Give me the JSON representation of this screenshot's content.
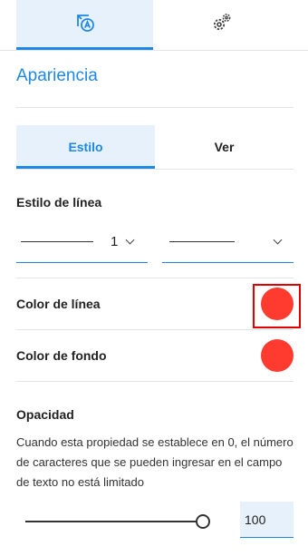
{
  "top_tabs": [
    {
      "icon": "appearance-icon",
      "active": true
    },
    {
      "icon": "gear-icon",
      "active": false
    }
  ],
  "section": {
    "title": "Apariencia"
  },
  "sub_tabs": [
    {
      "label": "Estilo",
      "active": true
    },
    {
      "label": "Ver",
      "active": false
    }
  ],
  "line_style": {
    "label": "Estilo de línea",
    "width_value": "1"
  },
  "line_color": {
    "label": "Color de línea",
    "color": "#ff3b2f"
  },
  "fill_color": {
    "label": "Color de fondo",
    "color": "#ff3b2f"
  },
  "opacity": {
    "label": "Opacidad",
    "description": "Cuando esta propiedad se establece en 0, el número de caracteres que se pueden ingresar en el campo de texto no está limitado",
    "value": "100",
    "slider_fraction": 1.0
  },
  "colors": {
    "accent": "#1e88e5",
    "accent_bg": "#e6f1fb",
    "highlight": "#e00000"
  }
}
